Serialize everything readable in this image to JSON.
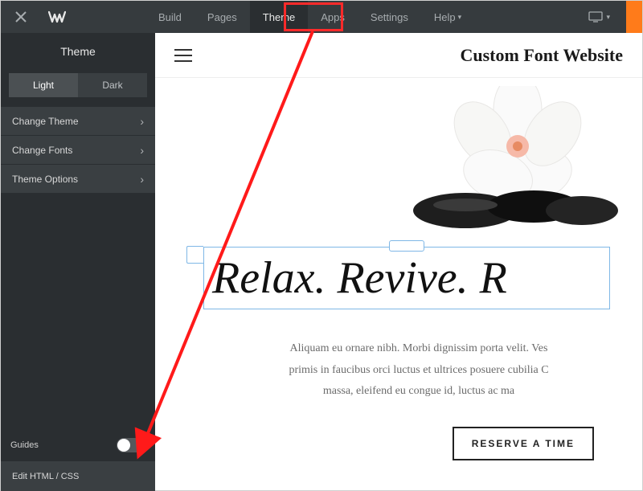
{
  "topbar": {
    "nav": [
      {
        "label": "Build"
      },
      {
        "label": "Pages"
      },
      {
        "label": "Theme",
        "active": true
      },
      {
        "label": "Apps"
      },
      {
        "label": "Settings"
      },
      {
        "label": "Help"
      }
    ]
  },
  "sidebar": {
    "title": "Theme",
    "segmented": {
      "light": "Light",
      "dark": "Dark",
      "active": "light"
    },
    "items": [
      {
        "label": "Change Theme"
      },
      {
        "label": "Change Fonts"
      },
      {
        "label": "Theme Options"
      }
    ],
    "guides_label": "Guides",
    "edit_html_label": "Edit HTML / CSS"
  },
  "site": {
    "title": "Custom Font Website",
    "headline": "Relax. Revive. R",
    "paragraph_lines": [
      "Aliquam eu ornare nibh. Morbi dignissim porta velit. Ves",
      "primis in faucibus orci luctus et ultrices posuere cubilia C",
      "massa, eleifend eu congue id, luctus ac ma"
    ],
    "cta": "RESERVE A TIME"
  }
}
